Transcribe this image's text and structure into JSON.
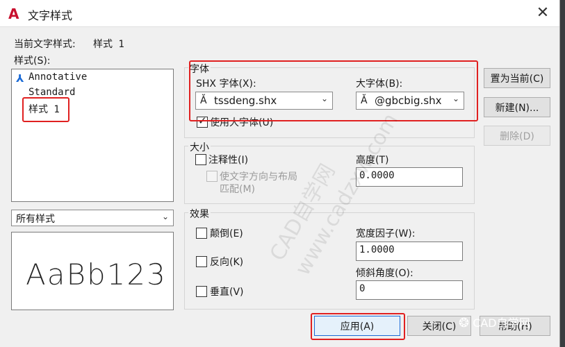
{
  "window": {
    "title": "文字样式",
    "logo_letter": "A",
    "close_glyph": "✕"
  },
  "current_style": {
    "label": "当前文字样式:",
    "value": "样式 1"
  },
  "styles_label": "样式(S):",
  "styles_list": [
    {
      "label": "Annotative",
      "icon": "annotative-icon",
      "icon_glyph": "⅄"
    },
    {
      "label": "Standard"
    },
    {
      "label": "样式 1",
      "selected": true
    }
  ],
  "filter_combo": {
    "value": "所有样式",
    "arrow": "⌄"
  },
  "preview_text": "AaBb123",
  "font_group": {
    "title": "字体",
    "shx_label": "SHX 字体(X):",
    "shx_value": "tssdeng.shx",
    "big_label": "大字体(B):",
    "big_value": "@gbcbig.shx",
    "use_big_label": "使用大字体(U)",
    "use_big_checked": true,
    "arrow": "⌄",
    "font_icon_glyph": "Ă"
  },
  "size_group": {
    "title": "大小",
    "annotative_label": "注释性(I)",
    "orient_label_1": "使文字方向与布局",
    "orient_label_2": "匹配(M)",
    "height_label": "高度(T)",
    "height_value": "0.0000"
  },
  "effects_group": {
    "title": "效果",
    "upside_down": "颠倒(E)",
    "backwards": "反向(K)",
    "vertical": "垂直(V)",
    "width_label": "宽度因子(W):",
    "width_value": "1.0000",
    "oblique_label": "倾斜角度(O):",
    "oblique_value": "0"
  },
  "buttons": {
    "set_current": "置为当前(C)",
    "new": "新建(N)...",
    "delete": "删除(D)",
    "apply": "应用(A)",
    "close": "关闭(C)",
    "help": "帮助(H)"
  },
  "watermark": {
    "line1": "CAD自学网",
    "line2": "www.cadzxw.com",
    "corner": "CAD自学网"
  },
  "colors": {
    "highlight_red": "#e02020",
    "logo_red": "#c8102e",
    "accent_blue": "#1a6ad6"
  }
}
